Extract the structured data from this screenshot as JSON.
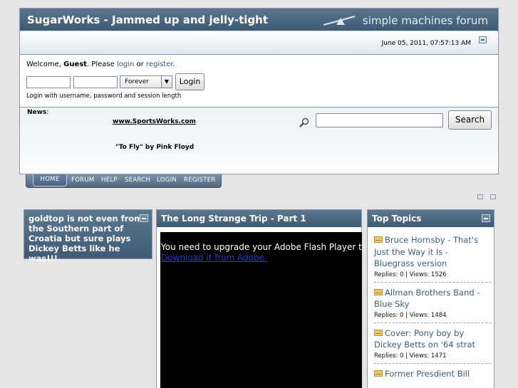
{
  "header": {
    "title": "SugarWorks - Jammed up and jelly-tight",
    "forum_brand": "simple machines forum",
    "datetime": "June 05, 2011, 07:57:13 AM"
  },
  "login": {
    "welcome_prefix": "Welcome, ",
    "guest": "Guest",
    "please": ". Please ",
    "login_link": "login",
    "or": " or ",
    "register_link": "register",
    "period": ".",
    "session_value": "Forever",
    "button": "Login",
    "hint": "Login with username, password and session length"
  },
  "news": {
    "label": "News",
    "colon": ":",
    "link": "www.SportsWorks.com",
    "song": "\"To Fly\" by Pink Floyd"
  },
  "search": {
    "button": "Search"
  },
  "nav": [
    "HOME",
    "FORUM",
    "HELP",
    "SEARCH",
    "LOGIN",
    "REGISTER"
  ],
  "left_panel": {
    "title": "goldtop is not even from the Southern part of Croatia but sure plays Dickey Betts like he was!!!"
  },
  "center_panel": {
    "title": "The Long Strange Trip - Part 1",
    "flash_message": "You need to upgrade your Adobe Flash Player to w",
    "flash_link": "Download it from Adobe."
  },
  "right_panel": {
    "title": "Top Topics",
    "topics": [
      {
        "title": "Bruce Hornsby - That's Just the Way it Is - Bluegrass version",
        "stats": "Replies: 0 | Views: 1526"
      },
      {
        "title": "Allman Brothers Band - Blue Sky",
        "stats": "Replies: 0 | Views: 1484"
      },
      {
        "title": "Cover: Pony boy by Dickey Betts on '64 strat",
        "stats": "Replies: 0 | Views: 1471"
      },
      {
        "title": "Former Presdient Bill",
        "stats": ""
      }
    ]
  },
  "colors": {
    "header_blue": "#3f5a73",
    "link_blue": "#3a5f82"
  }
}
